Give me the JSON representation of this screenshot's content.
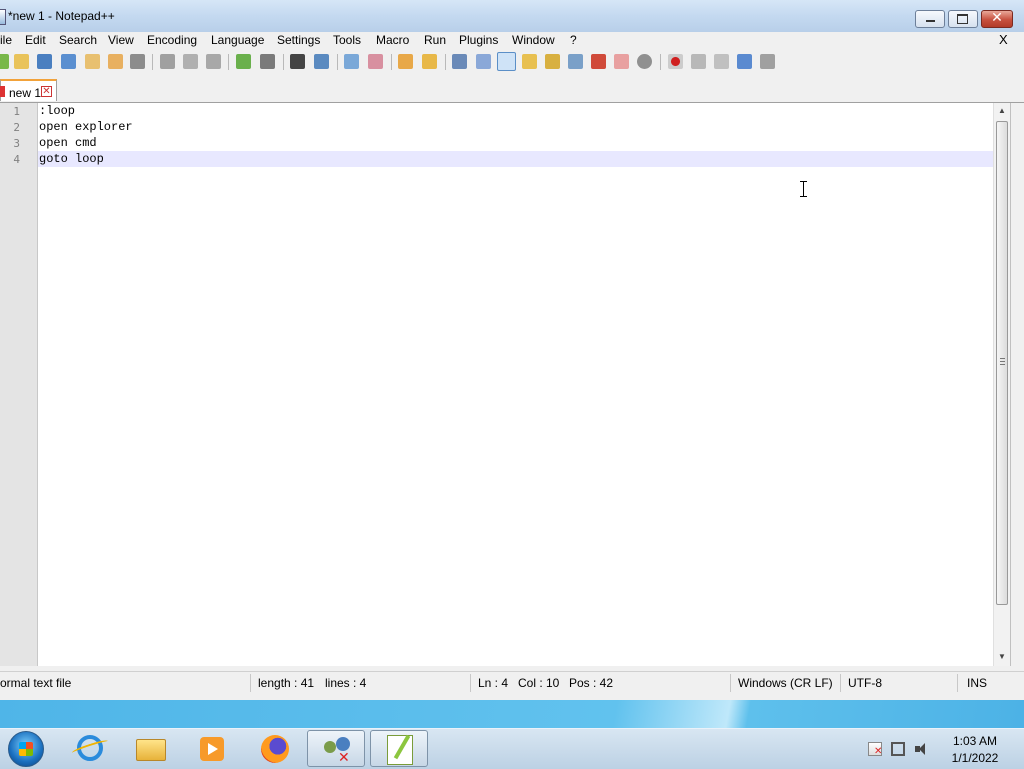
{
  "window": {
    "title": "*new 1 - Notepad++",
    "close_glyph": "✕"
  },
  "menu": {
    "items": [
      "ile",
      "Edit",
      "Search",
      "View",
      "Encoding",
      "Language",
      "Settings",
      "Tools",
      "Macro",
      "Run",
      "Plugins",
      "Window",
      "?"
    ],
    "close_x": "X"
  },
  "toolbar": {
    "icons": [
      "new-icon",
      "open-icon",
      "save-icon",
      "save-all-icon",
      "close-icon",
      "close-all-icon",
      "print-icon",
      "cut-icon",
      "copy-icon",
      "paste-icon",
      "undo-icon",
      "redo-icon",
      "find-icon",
      "replace-icon",
      "zoom-in-icon",
      "zoom-out-icon",
      "sync-vertical-icon",
      "sync-horizontal-icon",
      "word-wrap-icon",
      "show-all-chars-icon",
      "indent-guide-icon",
      "user-language-icon",
      "doc-map-icon",
      "function-list-icon",
      "folder-as-workspace-icon",
      "monitoring-icon",
      "document-list-icon",
      "clipboard-history-icon",
      "record-macro-icon",
      "stop-record-icon",
      "playback-macro-icon",
      "run-macro-multiple-icon",
      "save-macro-icon"
    ]
  },
  "tabs": [
    {
      "label": "new 1",
      "close": "✕"
    }
  ],
  "editor": {
    "line_numbers": [
      "1",
      "2",
      "3",
      "4"
    ],
    "lines": [
      ":loop",
      "open explorer",
      "open cmd",
      "goto loop"
    ],
    "current_line": 4
  },
  "status": {
    "doc_type": "ormal text file",
    "length": "length : 41",
    "lines": "lines : 4",
    "ln": "Ln : 4",
    "col": "Col : 10",
    "pos": "Pos : 42",
    "eol": "Windows (CR LF)",
    "encoding": "UTF-8",
    "mode": "INS"
  },
  "taskbar": {
    "apps": [
      "internet-explorer",
      "file-explorer",
      "media-player",
      "firefox",
      "user-accounts",
      "notepad-plus-plus"
    ],
    "clock_time": "1:03 AM",
    "clock_date": "1/1/2022"
  }
}
